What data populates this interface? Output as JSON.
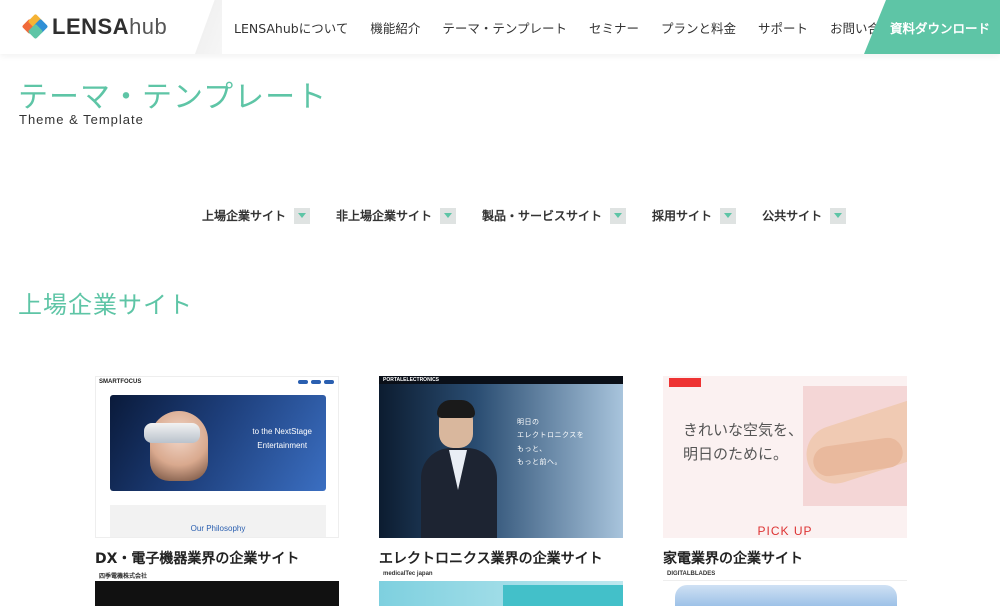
{
  "header": {
    "logo_text_bold": "LENSA",
    "logo_text_light": "hub",
    "nav": [
      {
        "label": "LENSAhubについて"
      },
      {
        "label": "機能紹介"
      },
      {
        "label": "テーマ・テンプレート"
      },
      {
        "label": "セミナー"
      },
      {
        "label": "プランと料金"
      },
      {
        "label": "サポート"
      },
      {
        "label": "お問い合わせ"
      }
    ],
    "cta_label": "資料ダウンロード"
  },
  "page": {
    "title": "テーマ・テンプレート",
    "subtitle": "Theme & Template"
  },
  "filters": [
    {
      "label": "上場企業サイト"
    },
    {
      "label": "非上場企業サイト"
    },
    {
      "label": "製品・サービスサイト"
    },
    {
      "label": "採用サイト"
    },
    {
      "label": "公共サイト"
    }
  ],
  "section": {
    "title": "上場企業サイト"
  },
  "cards": [
    {
      "caption": "DX・電子機器業界の企業サイト",
      "thumb_brand": "SMARTFOCUS",
      "thumb_copy_1": "to the NextStage",
      "thumb_copy_2": "Entertainment",
      "thumb_panel": "Our Philosophy"
    },
    {
      "caption": "エレクトロニクス業界の企業サイト",
      "thumb_brand": "PORTALELECTRONICS",
      "thumb_copy_1": "明日の",
      "thumb_copy_2": "エレクトロニクスを",
      "thumb_copy_3": "もっと、",
      "thumb_copy_4": "もっと前へ。"
    },
    {
      "caption": "家電業界の企業サイト",
      "thumb_copy_1": "きれいな空気を、",
      "thumb_copy_2": "明日のために。",
      "thumb_panel": "PICK UP"
    }
  ],
  "peeks": [
    {
      "label": "四季電機株式会社"
    },
    {
      "label": "medicalTec japan"
    },
    {
      "label": "DIGITALBLADES"
    }
  ],
  "colors": {
    "accent": "#5ec5a6"
  }
}
